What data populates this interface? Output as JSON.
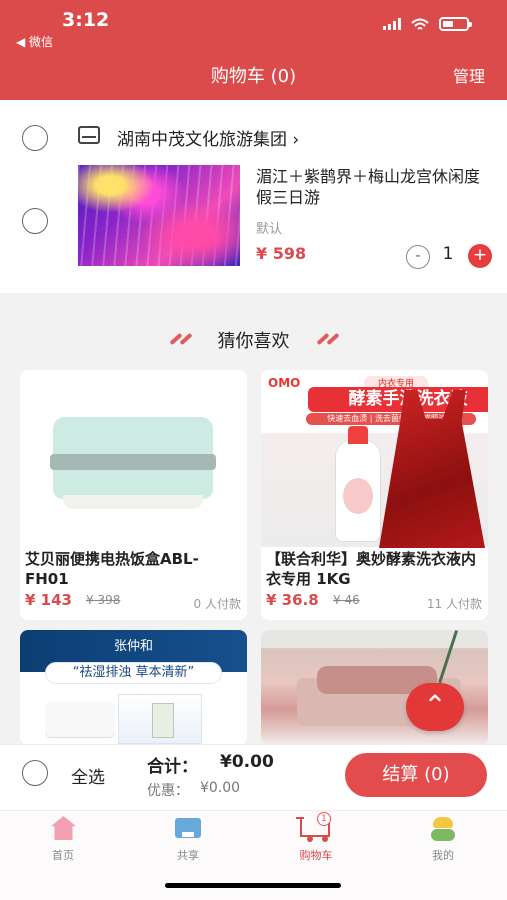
{
  "status_bar": {
    "time": "3:12",
    "back_app": "◀ 微信"
  },
  "header": {
    "title": "购物车 (0)",
    "manage_label": "管理"
  },
  "cart": {
    "shop_name": "湖南中茂文化旅游集团",
    "shop_chevron": "›",
    "item": {
      "title": "湄江＋紫鹊界＋梅山龙宫休闲度假三日游",
      "variant": "默认",
      "price": "¥ 598",
      "quantity": "1"
    }
  },
  "recommend": {
    "title": "猜你喜欢",
    "products": [
      {
        "name": "艾贝丽便携电热饭盒ABL-FH01",
        "price": "¥ 143",
        "old_price": "¥ 398",
        "sales": "0 人付款"
      },
      {
        "name": "【联合利华】奥妙酵素洗衣液内衣专用 1KG",
        "price": "¥ 36.8",
        "old_price": "¥ 46",
        "sales": "11 人付款"
      }
    ],
    "product_ads": {
      "omo_brand": "OMO",
      "omo_tag": "内衣专用",
      "omo_title": "酵素手洗洗衣液",
      "omo_features": "快速去血渍 | 洗去菌螨 | 敏感肌适用",
      "health_brand": "张仲和",
      "health_slogan": "“祛湿排浊  草本清新”"
    }
  },
  "checkout": {
    "select_all": "全选",
    "total_label": "合计：",
    "total_amount": "¥0.00",
    "discount_label": "优惠：",
    "discount_amount": "¥0.00",
    "checkout_label": "结算 (0)"
  },
  "tabs": [
    {
      "label": "首页"
    },
    {
      "label": "共享"
    },
    {
      "label": "购物车",
      "badge": "1"
    },
    {
      "label": "我的"
    }
  ],
  "colors": {
    "brand_red": "#dc4b4b",
    "price_red": "#dc4b4b",
    "background": "#f2f2f2"
  },
  "icons": [
    "home-icon",
    "share-icon",
    "cart-icon",
    "profile-icon",
    "scroll-top-icon",
    "shop-icon"
  ]
}
